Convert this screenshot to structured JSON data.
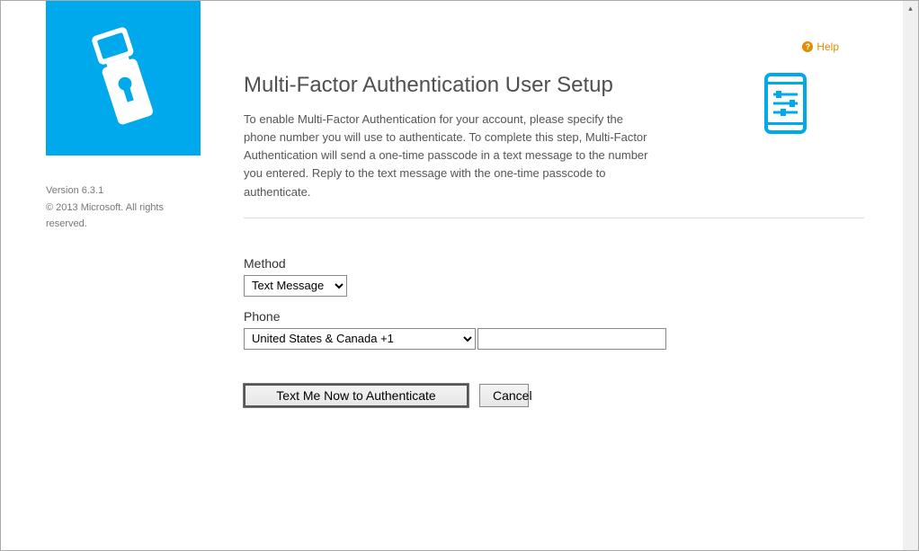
{
  "sidebar": {
    "version_label": "Version 6.3.1",
    "copyright": "© 2013 Microsoft. All rights reserved."
  },
  "help": {
    "label": "Help"
  },
  "header": {
    "title": "Multi-Factor Authentication User Setup",
    "description": "To enable Multi-Factor Authentication for your account, please specify the phone number you will use to authenticate. To complete this step, Multi-Factor Authentication will send a one-time passcode in a text message to the number you entered. Reply to the text message with the one-time passcode to authenticate."
  },
  "form": {
    "method": {
      "label": "Method",
      "selected": "Text Message"
    },
    "phone": {
      "label": "Phone",
      "country_selected": "United States & Canada +1",
      "number_value": ""
    },
    "buttons": {
      "submit": "Text Me Now to Authenticate",
      "cancel": "Cancel"
    }
  }
}
